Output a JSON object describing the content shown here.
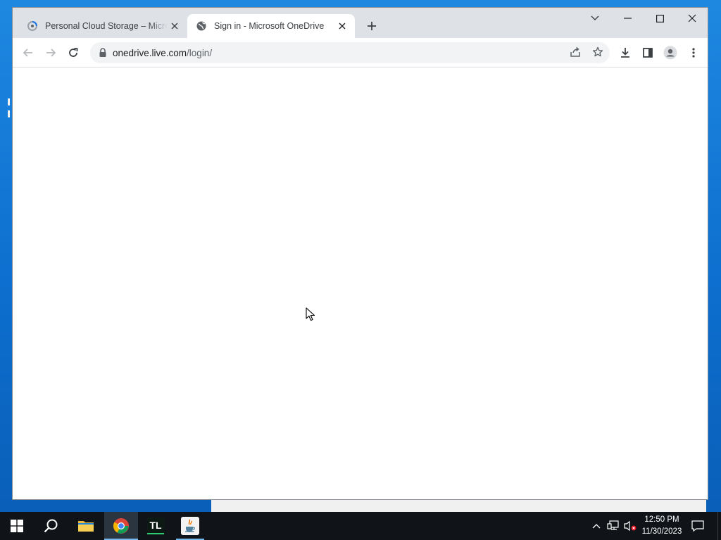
{
  "browser": {
    "tabs": [
      {
        "title": "Personal Cloud Storage – Microsoft OneDrive",
        "active": false,
        "favicon": "onedrive-loading-icon"
      },
      {
        "title": "Sign in - Microsoft OneDrive",
        "active": true,
        "favicon": "globe-icon"
      }
    ],
    "address": {
      "host": "onedrive.live.com",
      "path": "/login/"
    },
    "toolbar_icons": [
      "back-arrow-icon",
      "forward-arrow-icon",
      "reload-icon",
      "lock-icon",
      "share-icon",
      "star-icon",
      "download-icon",
      "side-panel-icon",
      "profile-icon",
      "kebab-menu-icon"
    ],
    "window_controls": [
      "tab-search-icon",
      "minimize-icon",
      "maximize-icon",
      "close-icon"
    ]
  },
  "taskbar": {
    "apps": [
      "windows-start-icon",
      "search-icon",
      "file-explorer-icon",
      "chrome-icon",
      "tl-app-icon",
      "java-icon"
    ],
    "tl_label": "TL",
    "tray_icons": [
      "chevron-up-icon",
      "network-icon",
      "speaker-muted-icon"
    ],
    "time": "12:50 PM",
    "date": "11/30/2023"
  },
  "colors": {
    "desktop": "#0d6fcf",
    "taskbar": "#101418",
    "tabstrip": "#dee1e6",
    "accent": "#76b9ed"
  }
}
